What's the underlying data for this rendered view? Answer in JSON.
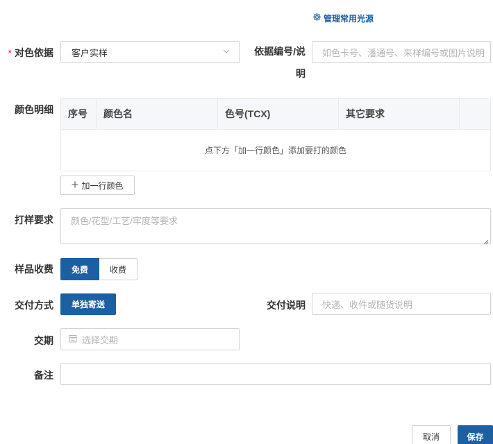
{
  "header": {
    "manage_light_label": "管理常用光源",
    "manage_light_icon": "gear-icon"
  },
  "form": {
    "basis": {
      "label": "对色依据",
      "required": "*",
      "value": "客户实样",
      "icon": "chevron-down-icon"
    },
    "basis_no": {
      "label_line1": "依据编号/说",
      "label_line2": "明",
      "placeholder": "如色卡号、潘通号、来样编号或图片说明"
    },
    "colors": {
      "label": "颜色明细",
      "columns": [
        "序号",
        "颜色名",
        "色号(TCX)",
        "其它要求",
        ""
      ],
      "empty_text": "点下方「加一行颜色」添加要打的颜色",
      "add_row_label": "加一行颜色",
      "add_row_icon": "plus-icon"
    },
    "sample_req": {
      "label": "打样要求",
      "placeholder": "颜色/花型/工艺/牢度等要求"
    },
    "fee": {
      "label": "样品收费",
      "options": [
        "免费",
        "收费"
      ],
      "selected": "免费"
    },
    "delivery": {
      "label": "交付方式",
      "option": "单独寄送",
      "note_label": "交付说明",
      "note_placeholder": "快递、收件或随货说明"
    },
    "due": {
      "label": "交期",
      "placeholder": "选择交期",
      "icon": "calendar-icon"
    },
    "remark": {
      "label": "备注",
      "value": ""
    }
  },
  "footer": {
    "cancel_label": "取消",
    "save_label": "保存"
  },
  "colors": {
    "primary": "#1d5fa3",
    "required": "#e02020",
    "border": "#d4d4d4",
    "table_header_bg": "#f5f7fa"
  }
}
